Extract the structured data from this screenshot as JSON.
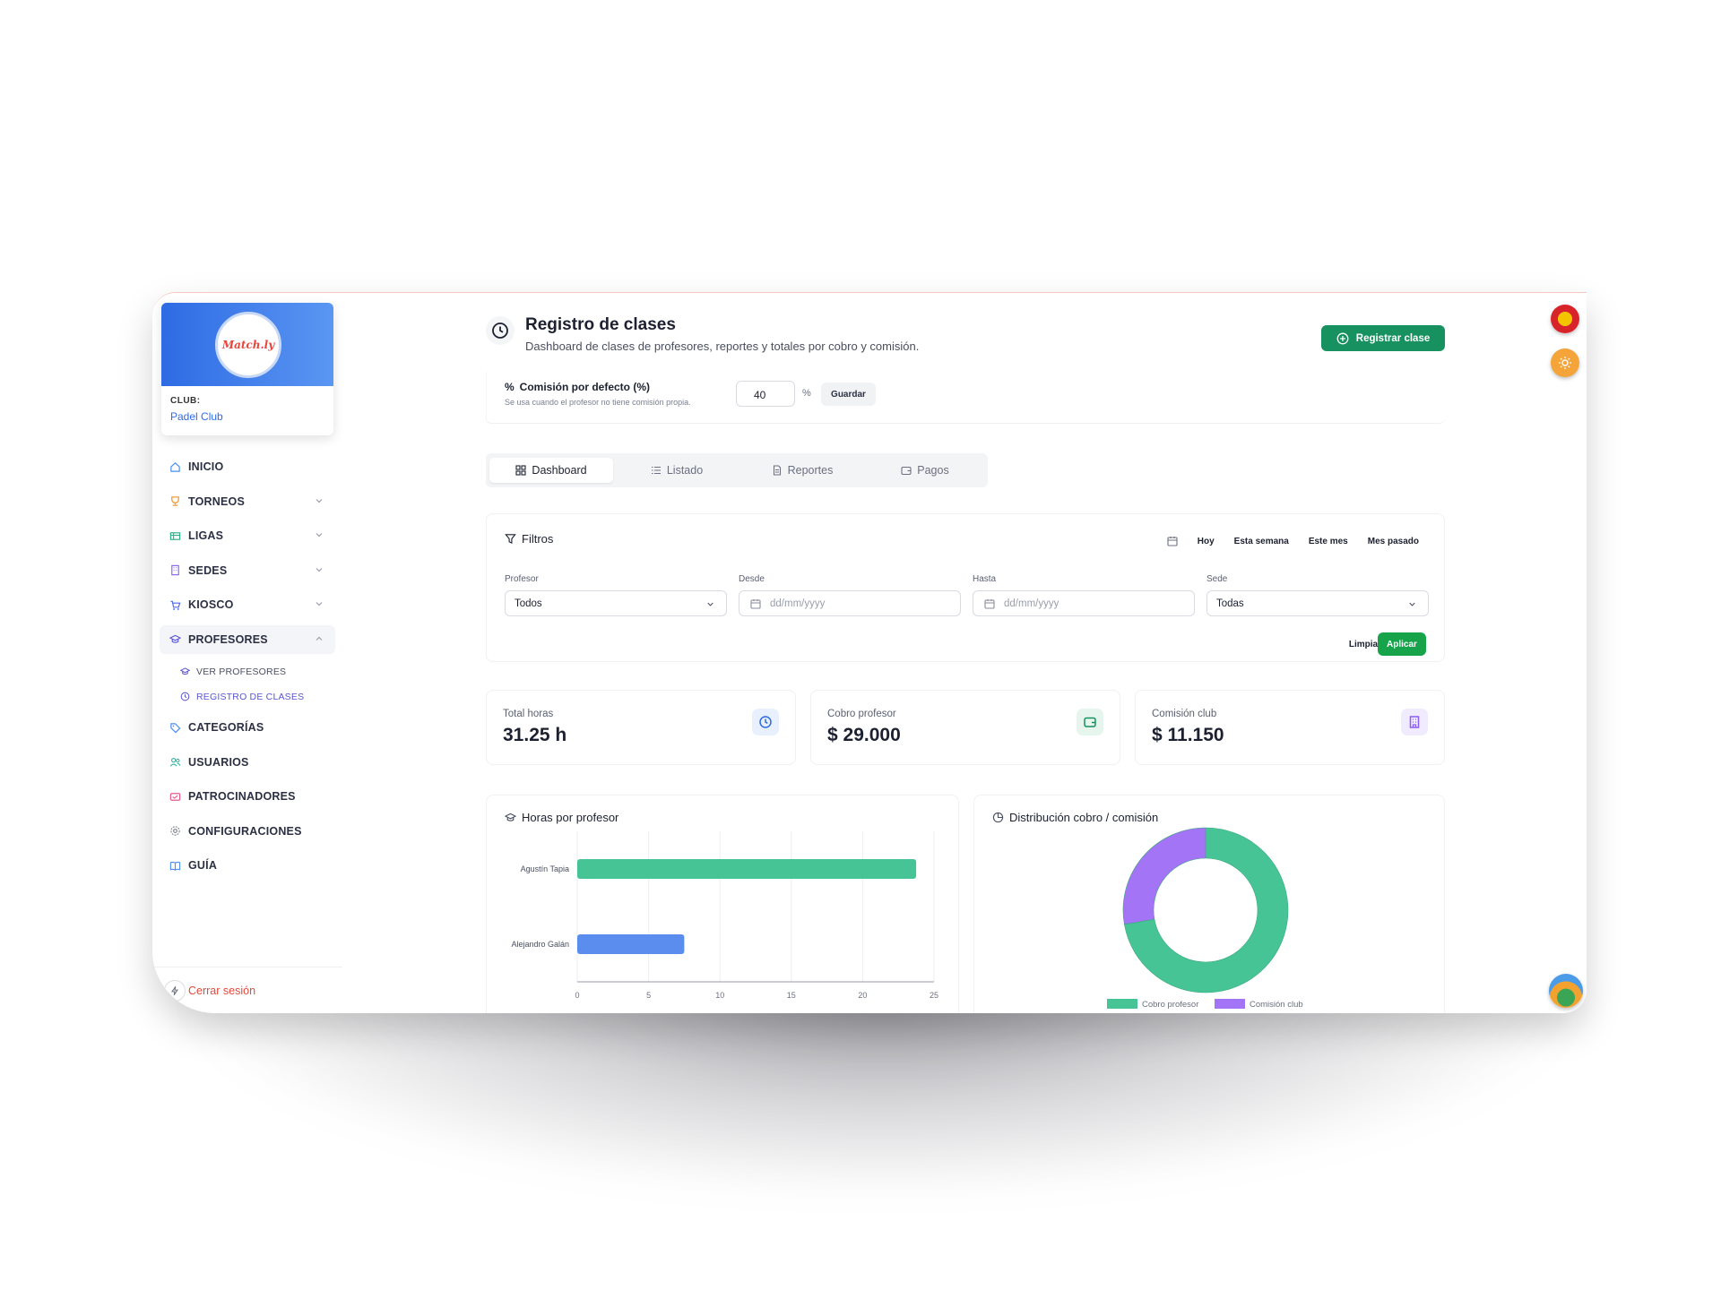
{
  "sidebar": {
    "club_label": "CLUB:",
    "club_name": "Padel Club",
    "logo_text": "Match.ly",
    "items": [
      {
        "label": "INICIO",
        "icon": "home-icon",
        "color": "#4c8df0"
      },
      {
        "label": "TORNEOS",
        "icon": "trophy-icon",
        "color": "#f29a38"
      },
      {
        "label": "LIGAS",
        "icon": "table-icon",
        "color": "#2fb38a"
      },
      {
        "label": "SEDES",
        "icon": "building-icon",
        "color": "#8b6cf0"
      },
      {
        "label": "KIOSCO",
        "icon": "cart-icon",
        "color": "#4c6af0"
      },
      {
        "label": "PROFESORES",
        "icon": "graduation-cap-icon",
        "color": "#5a55d6"
      }
    ],
    "sub_items": [
      {
        "label": "VER PROFESORES",
        "icon": "graduation-cap-icon"
      },
      {
        "label": "REGISTRO DE CLASES",
        "icon": "clock-icon"
      }
    ],
    "items_after": [
      {
        "label": "CATEGORÍAS",
        "icon": "tag-icon",
        "color": "#4c8df0"
      },
      {
        "label": "USUARIOS",
        "icon": "users-icon",
        "color": "#2fb3a0"
      },
      {
        "label": "PATROCINADORES",
        "icon": "handshake-icon",
        "color": "#e85a8a"
      },
      {
        "label": "CONFIGURACIONES",
        "icon": "gear-icon",
        "color": "#7a7f90"
      },
      {
        "label": "GUÍA",
        "icon": "book-icon",
        "color": "#4c8df0"
      }
    ],
    "logout_label": "Cerrar sesión"
  },
  "header": {
    "title": "Registro de clases",
    "subtitle": "Dashboard de clases de profesores, reportes y totales por cobro y comisión.",
    "register_button": "Registrar clase"
  },
  "commission": {
    "title": "Comisión por defecto (%)",
    "hint": "Se usa cuando el profesor no tiene comisión propia.",
    "value": "40",
    "unit": "%",
    "save_button": "Guardar"
  },
  "tabs": [
    {
      "label": "Dashboard",
      "icon": "grid-icon"
    },
    {
      "label": "Listado",
      "icon": "list-icon"
    },
    {
      "label": "Reportes",
      "icon": "document-icon"
    },
    {
      "label": "Pagos",
      "icon": "wallet-icon"
    }
  ],
  "filters": {
    "title": "Filtros",
    "quick": [
      "Hoy",
      "Esta semana",
      "Este mes",
      "Mes pasado"
    ],
    "profesor_label": "Profesor",
    "profesor_value": "Todos",
    "desde_label": "Desde",
    "desde_placeholder": "dd/mm/yyyy",
    "hasta_label": "Hasta",
    "hasta_placeholder": "dd/mm/yyyy",
    "sede_label": "Sede",
    "sede_value": "Todas",
    "clear_button": "Limpiar",
    "apply_button": "Aplicar"
  },
  "stats": [
    {
      "label": "Total horas",
      "value": "31.25 h",
      "icon": "clock-icon",
      "color": "#2e6be4",
      "bg": "#e8f0fe"
    },
    {
      "label": "Cobro profesor",
      "value": "$ 29.000",
      "icon": "wallet-icon",
      "color": "#16915f",
      "bg": "#e6f6ee"
    },
    {
      "label": "Comisión club",
      "value": "$ 11.150",
      "icon": "building-icon",
      "color": "#8b5cf6",
      "bg": "#f0ebfe"
    }
  ],
  "charts": {
    "bar_title": "Horas por profesor",
    "pie_title": "Distribución cobro / comisión"
  },
  "chart_data": [
    {
      "type": "bar",
      "orientation": "horizontal",
      "title": "Horas por profesor",
      "categories": [
        "Agustín Tapia",
        "Alejandro Galán"
      ],
      "values": [
        23.75,
        7.5
      ],
      "colors": [
        "#47c495",
        "#5b8def"
      ],
      "xlim": [
        0,
        25
      ],
      "xticks": [
        0,
        5,
        10,
        15,
        20,
        25
      ],
      "grid": true
    },
    {
      "type": "pie",
      "title": "Distribución cobro / comisión",
      "labels": [
        "Cobro profesor",
        "Comisión club"
      ],
      "values": [
        29000,
        11150
      ],
      "colors": [
        "#47c495",
        "#a374f5"
      ],
      "donut": true,
      "legend": "bottom"
    }
  ]
}
